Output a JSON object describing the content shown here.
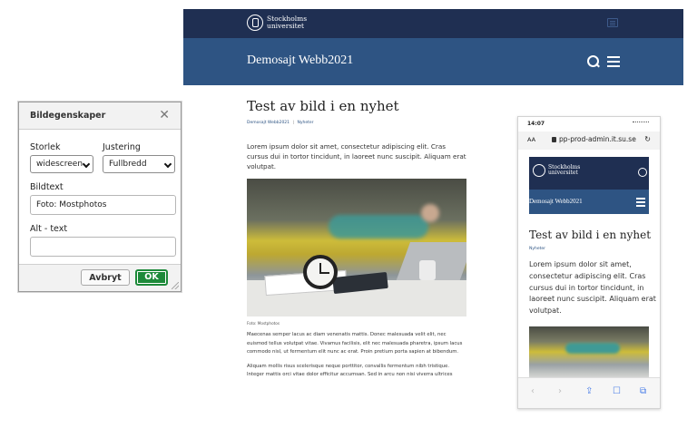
{
  "site": {
    "logo_line1": "Stockholms",
    "logo_line2": "universitet",
    "site_name": "Demosajt Webb2021",
    "article": {
      "title": "Test av bild i en nyhet",
      "breadcrumb_home": "Demosajt Webb2021",
      "breadcrumb_sep": "|",
      "breadcrumb_section": "Nyheter",
      "lead": "Lorem ipsum dolor sit amet, consectetur adipiscing elit. Cras cursus dui in tortor tincidunt, in laoreet nunc suscipit. Aliquam erat volutpat.",
      "caption": "Foto: Mostphotos",
      "para1": "Maecenas semper lacus ac diam venenatis mattis. Donec malesuada velit elit, nec euismod tellus volutpat vitae. Vivamus facilisis, elit nec malesuada pharetra, ipsum lacus commodo nisl, ut fermentum elit nunc ac erat. Proin pretium porta sapien at bibendum.",
      "para2": "Aliquam mollis risus scelerisque neque porttitor, convallis fermentum nibh tristique. Integer mattis orci vitae dolor efficitur accumsan. Sed in arcu non nisi viverra ultrices"
    }
  },
  "dialog": {
    "title": "Bildegenskaper",
    "close_glyph": "✕",
    "size_label": "Storlek",
    "size_value": "widescreen",
    "align_label": "Justering",
    "align_value": "Fullbredd",
    "caption_label": "Bildtext",
    "caption_value": "Foto: Mostphotos",
    "alt_label": "Alt - text",
    "alt_value": "",
    "cancel_label": "Avbryt",
    "ok_label": "OK"
  },
  "phone": {
    "time": "14:07",
    "aa": "AA",
    "host": "pp-prod-admin.it.su.se",
    "reload_glyph": "↻",
    "logo_line1": "Stockholms",
    "logo_line2": "universitet",
    "site_name": "Demosajt Webb2021",
    "title": "Test av bild i en nyhet",
    "breadcrumb": "Nyheter",
    "lead": "Lorem ipsum dolor sit amet, consectetur adipiscing elit. Cras cursus dui in tortor tincidunt, in laoreet nunc suscipit. Aliquam erat volutpat.",
    "toolbar": [
      "‹",
      "›",
      "⇪",
      "☐",
      "⧉"
    ]
  },
  "colors": {
    "header_dark": "#1f2f52",
    "header_blue": "#2e5483",
    "ok_green": "#1d8a3a"
  }
}
